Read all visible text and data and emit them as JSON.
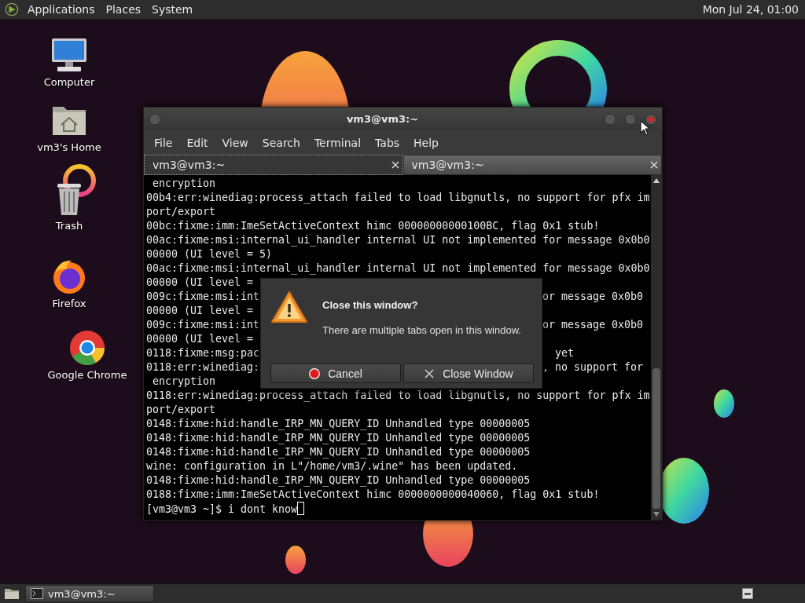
{
  "top_panel": {
    "menus": [
      "Applications",
      "Places",
      "System"
    ],
    "clock": "Mon Jul 24, 01:00"
  },
  "desktop_icons": [
    {
      "kind": "computer",
      "label": "Computer"
    },
    {
      "kind": "home",
      "label": "vm3's Home"
    },
    {
      "kind": "trash",
      "label": "Trash"
    },
    {
      "kind": "firefox",
      "label": "Firefox"
    },
    {
      "kind": "chrome",
      "label": "Google Chrome"
    }
  ],
  "terminal": {
    "title": "vm3@vm3:~",
    "menu": [
      "File",
      "Edit",
      "View",
      "Search",
      "Terminal",
      "Tabs",
      "Help"
    ],
    "tabs": [
      {
        "label": "vm3@vm3:~",
        "selected": true
      },
      {
        "label": "vm3@vm3:~",
        "selected": false
      }
    ],
    "lines": [
      {
        "text": " encryption"
      },
      {
        "text": "00b4:err:winediag:process_attach failed to load libgnutls, no support for pfx im"
      },
      {
        "text": "port/export"
      },
      {
        "text": "00bc:fixme:imm:ImeSetActiveContext himc 00000000000100BC, flag 0x1 stub!"
      },
      {
        "text": "00ac:fixme:msi:internal_ui_handler internal UI not implemented for message 0x0b0"
      },
      {
        "text": "00000 (UI level = 5)"
      },
      {
        "text": "00ac:fixme:msi:internal_ui_handler internal UI not implemented for message 0x0b0"
      },
      {
        "left": "00000 (UI level ="
      },
      {
        "left": "009c:fixme:msi:int",
        "right": "or message 0x0b0"
      },
      {
        "left": "00000 (UI level ="
      },
      {
        "left": "009c:fixme:msi:int",
        "right": "or message 0x0b0"
      },
      {
        "left": "00000 (UI level ="
      },
      {
        "left": "0118:fixme:msg:pac",
        "right": "  yet"
      },
      {
        "left": "0118:err:winediag:",
        "right": ", no support for"
      },
      {
        "text": " encryption"
      },
      {
        "text": "0118:err:winediag:process_attach failed to load libgnutls, no support for pfx im"
      },
      {
        "text": "port/export"
      },
      {
        "text": "0148:fixme:hid:handle_IRP_MN_QUERY_ID Unhandled type 00000005"
      },
      {
        "text": "0148:fixme:hid:handle_IRP_MN_QUERY_ID Unhandled type 00000005"
      },
      {
        "text": "0148:fixme:hid:handle_IRP_MN_QUERY_ID Unhandled type 00000005"
      },
      {
        "text": "wine: configuration in L\"/home/vm3/.wine\" has been updated."
      },
      {
        "text": "0148:fixme:hid:handle_IRP_MN_QUERY_ID Unhandled type 00000005"
      },
      {
        "text": "0188:fixme:imm:ImeSetActiveContext himc 0000000000040060, flag 0x1 stub!"
      }
    ],
    "prompt": "[vm3@vm3 ~]$ i dont know"
  },
  "dialog": {
    "title": "Close this window?",
    "message": "There are multiple tabs open in this window.",
    "buttons": [
      {
        "kind": "cancel",
        "label": "Cancel"
      },
      {
        "kind": "close",
        "label": "Close Window"
      }
    ]
  },
  "taskbar": {
    "tasks": [
      {
        "label": "vm3@vm3:~"
      }
    ]
  }
}
